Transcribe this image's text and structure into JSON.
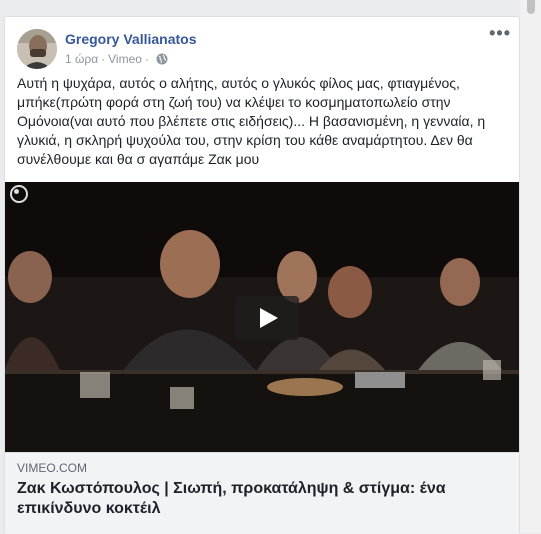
{
  "post": {
    "author": "Gregory Vallianatos",
    "time": "1 ώρα",
    "separator": "·",
    "source": "Vimeo",
    "more_label": "•••",
    "text": "Αυτή η ψυχάρα, αυτός ο αλήτης, αυτός ο γλυκός φίλος μας, φτιαγμένος, μπήκε(πρώτη φορά στη ζωή του) να κλέψει το κοσμηματοπωλείο στην Ομόνοια(ναι αυτό που βλέπετε στις ειδήσεις)... Η βασανισμένη, η γενναία, η γλυκιά, η σκληρή ψυχούλα του, στην κρίση του κάθε αναμάρτητου. Δεν θα συνέλθουμε και θα σ αγαπάμε Ζακ μου"
  },
  "link": {
    "domain": "VIMEO.COM",
    "title": "Ζακ Κωστόπουλος | Σιωπή, προκατάληψη & στίγμα: ένα επικίνδυνο κοκτέιλ"
  },
  "icons": {
    "privacy": "globe-icon",
    "menu": "more-options-icon",
    "play": "play-icon",
    "loading": "loading-icon"
  }
}
